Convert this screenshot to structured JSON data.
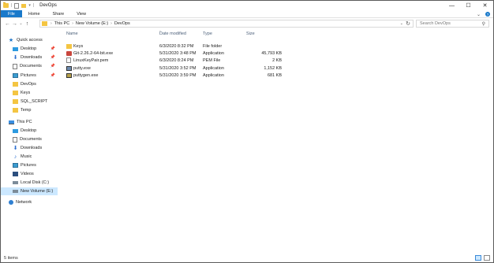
{
  "window": {
    "title": "DevOps",
    "controls": {
      "minimize": "—",
      "maximize": "☐",
      "close": "✕"
    }
  },
  "quick_access_toolbar": {
    "dropdown": "▾",
    "separator": "|"
  },
  "ribbon": {
    "tabs": [
      "File",
      "Home",
      "Share",
      "View"
    ],
    "expand": "⌄",
    "help": "?"
  },
  "address_bar": {
    "crumbs": [
      "This PC",
      "New Volume (E:)",
      "DevOps"
    ],
    "separator": "›",
    "dropdown": "⌄",
    "refresh": "↻"
  },
  "nav_buttons": {
    "back": "←",
    "forward": "→",
    "recent": "⌄",
    "up": "↑"
  },
  "search": {
    "placeholder": "Search DevOps",
    "icon": "search-icon"
  },
  "nav_pane": {
    "quick_access": {
      "label": "Quick access",
      "items": [
        {
          "label": "Desktop",
          "icon": "desktop-icon",
          "pinned": true
        },
        {
          "label": "Downloads",
          "icon": "download-icon",
          "pinned": true
        },
        {
          "label": "Documents",
          "icon": "document-icon",
          "pinned": true
        },
        {
          "label": "Pictures",
          "icon": "pictures-icon",
          "pinned": true
        },
        {
          "label": "DevOps",
          "icon": "folder-icon",
          "pinned": false
        },
        {
          "label": "Keys",
          "icon": "folder-icon",
          "pinned": false
        },
        {
          "label": "SQL_SCRIPT",
          "icon": "folder-icon",
          "pinned": false
        },
        {
          "label": "Temp",
          "icon": "folder-icon",
          "pinned": false
        }
      ]
    },
    "this_pc": {
      "label": "This PC",
      "items": [
        {
          "label": "Desktop",
          "icon": "desktop-icon"
        },
        {
          "label": "Documents",
          "icon": "document-icon"
        },
        {
          "label": "Downloads",
          "icon": "download-icon"
        },
        {
          "label": "Music",
          "icon": "music-icon"
        },
        {
          "label": "Pictures",
          "icon": "pictures-icon"
        },
        {
          "label": "Videos",
          "icon": "videos-icon"
        },
        {
          "label": "Local Disk (C:)",
          "icon": "disk-icon"
        },
        {
          "label": "New Volume (E:)",
          "icon": "disk-icon",
          "selected": true
        }
      ]
    },
    "network": {
      "label": "Network",
      "icon": "network-icon"
    },
    "pin_glyph": "📌"
  },
  "file_list": {
    "columns": {
      "name": "Name",
      "date": "Date modified",
      "type": "Type",
      "size": "Size"
    },
    "sort_indicator": "^",
    "rows": [
      {
        "name": "Keys",
        "date": "6/3/2020 8:32 PM",
        "type": "File folder",
        "size": "",
        "icon": "folder-icon"
      },
      {
        "name": "Git-2.26.2-64-bit.exe",
        "date": "5/31/2020 3:48 PM",
        "type": "Application",
        "size": "45,793 KB",
        "icon": "git-installer-icon"
      },
      {
        "name": "LinuxKeyPair.pem",
        "date": "6/3/2020 8:24 PM",
        "type": "PEM File",
        "size": "2 KB",
        "icon": "pem-file-icon"
      },
      {
        "name": "putty.exe",
        "date": "5/31/2020 3:52 PM",
        "type": "Application",
        "size": "1,152 KB",
        "icon": "putty-icon"
      },
      {
        "name": "puttygen.exe",
        "date": "5/31/2020 3:59 PM",
        "type": "Application",
        "size": "681 KB",
        "icon": "puttygen-icon"
      }
    ]
  },
  "status_bar": {
    "item_count": "5 items",
    "views": [
      "details-view-icon",
      "large-icons-view-icon"
    ]
  }
}
